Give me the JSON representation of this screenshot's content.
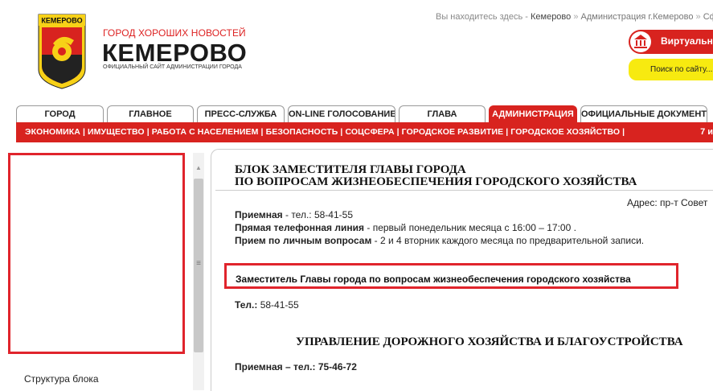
{
  "header": {
    "logo_text": "КЕМЕРОВО",
    "slogan": "ГОРОД ХОРОШИХ НОВОСТЕЙ",
    "city": "КЕМЕРОВО",
    "subtitle": "ОФИЦИАЛЬНЫЙ САЙТ АДМИНИСТРАЦИИ ГОРОДА",
    "breadcrumb": {
      "prefix": "Вы находитесь здесь - ",
      "items": [
        "Кемерово",
        "Администрация г.Кемерово",
        "Сфе"
      ],
      "separator": "»"
    },
    "virtual_label": "Виртуальн",
    "search_placeholder": "Поиск по сайту..."
  },
  "tabs": [
    {
      "label": "ГОРОД",
      "active": false
    },
    {
      "label": "ГЛАВНОЕ",
      "active": false
    },
    {
      "label": "ПРЕСС-СЛУЖБА",
      "active": false
    },
    {
      "label": "ON-LINE ГОЛОСОВАНИЕ",
      "active": false
    },
    {
      "label": "ГЛАВА",
      "active": false
    },
    {
      "label": "АДМИНИСТРАЦИЯ",
      "active": true
    },
    {
      "label": "ОФИЦИАЛЬНЫЕ ДОКУМЕНТЫ",
      "active": false
    }
  ],
  "subnav": {
    "items": [
      "ЭКОНОМИКА",
      "ИМУЩЕСТВО",
      "РАБОТА С НАСЕЛЕНИЕМ",
      "БЕЗОПАСНОСТЬ",
      "СОЦСФЕРА",
      "ГОРОДСКОЕ РАЗВИТИЕ",
      "ГОРОДСКОЕ ХОЗЯЙСТВО"
    ],
    "right": "7 и"
  },
  "sidebar": {
    "structure_link": "Структура блока"
  },
  "main": {
    "title_line1": "БЛОК ЗАМЕСТИТЕЛЯ ГЛАВЫ ГОРОДА",
    "title_line2": "ПО ВОПРОСАМ ЖИЗНЕОБЕСПЕЧЕНИЯ ГОРОДСКОГО ХОЗЯЙСТВА",
    "address": "Адрес: пр-т Совет",
    "reception_label": "Приемная",
    "reception_value": " - тел.: 58-41-55",
    "hotline_label": "Прямая телефонная линия",
    "hotline_value": " - первый понедельник месяца с 16:00 – 17:00 .",
    "personal_label": "Прием по личным вопросам",
    "personal_value": " - 2 и 4 вторник каждого месяца по предварительной записи.",
    "deputy": "Заместитель Главы города по вопросам жизнеобеспечения городского хозяйства",
    "phone_label": "Тел.:",
    "phone_value": " 58-41-55",
    "department": "УПРАВЛЕНИЕ ДОРОЖНОГО ХОЗЯЙСТВА И БЛАГОУСТРОЙСТВА",
    "dept_reception": "Приемная – тел.: 75-46-72"
  },
  "colors": {
    "brand_red": "#d8231f",
    "highlight_red": "#e0242c",
    "search_yellow": "#f7ea10"
  }
}
